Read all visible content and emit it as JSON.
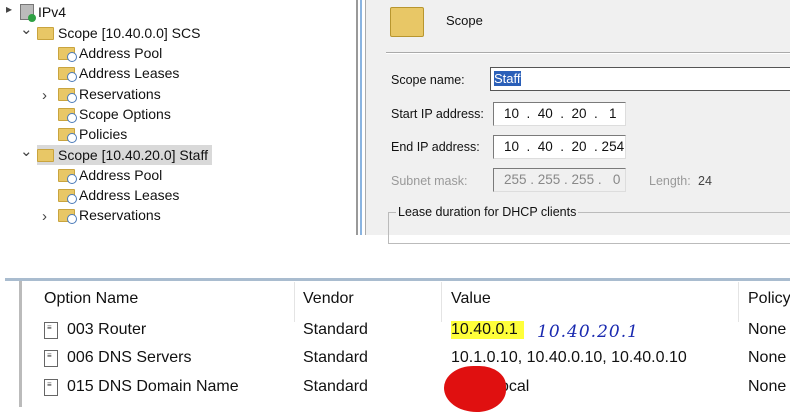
{
  "tree": {
    "root": "IPv4",
    "items": [
      {
        "label": "Scope [10.40.0.0] SCS",
        "level": 1,
        "expanded": true
      },
      {
        "label": "Address Pool",
        "level": 2
      },
      {
        "label": "Address Leases",
        "level": 2
      },
      {
        "label": "Reservations",
        "level": 2,
        "collapsed": true
      },
      {
        "label": "Scope Options",
        "level": 2
      },
      {
        "label": "Policies",
        "level": 2
      },
      {
        "label": "Scope [10.40.20.0] Staff",
        "level": 1,
        "expanded": true,
        "selected": true
      },
      {
        "label": "Address Pool",
        "level": 2
      },
      {
        "label": "Address Leases",
        "level": 2
      },
      {
        "label": "Reservations",
        "level": 2,
        "collapsed": true
      }
    ]
  },
  "scope_panel": {
    "title": "Scope",
    "scope_name_label": "Scope name:",
    "scope_name": "Staff",
    "start_label": "Start IP address:",
    "start_ip": "10  .  40  .  20  .   1",
    "end_label": "End IP address:",
    "end_ip": "10  .  40  .  20  . 254",
    "mask_label": "Subnet mask:",
    "mask": "255 . 255 . 255 .   0",
    "length_label": "Length:",
    "length": "24",
    "lease_group": "Lease duration for DHCP clients"
  },
  "options_table": {
    "columns": [
      "Option Name",
      "Vendor",
      "Value",
      "Policy"
    ],
    "rows": [
      {
        "name": "003 Router",
        "vendor": "Standard",
        "value": "10.40.0.1",
        "policy": "None"
      },
      {
        "name": "006 DNS Servers",
        "vendor": "Standard",
        "value": "10.1.0.10, 10.40.0.10, 10.40.0.10",
        "policy": "None"
      },
      {
        "name": "015 DNS Domain Name",
        "vendor": "Standard",
        "value": "ocal",
        "policy": "None"
      }
    ],
    "annotation": "10.40.20.1"
  },
  "colors": {
    "highlight": "#ffff3a",
    "redact": "#e01010",
    "ink": "#1a2ab0"
  }
}
